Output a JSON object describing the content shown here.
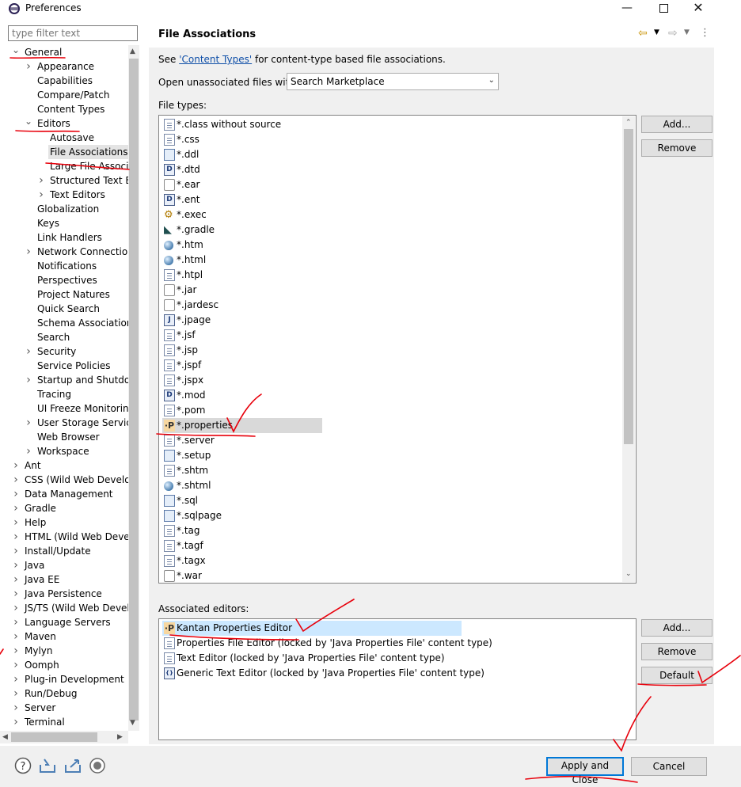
{
  "window": {
    "title": "Preferences"
  },
  "filter": {
    "placeholder": "type filter text"
  },
  "tree": [
    {
      "label": "General",
      "depth": 0,
      "expanded": true
    },
    {
      "label": "Appearance",
      "depth": 1,
      "expandable": true
    },
    {
      "label": "Capabilities",
      "depth": 1
    },
    {
      "label": "Compare/Patch",
      "depth": 1
    },
    {
      "label": "Content Types",
      "depth": 1
    },
    {
      "label": "Editors",
      "depth": 1,
      "expanded": true
    },
    {
      "label": "Autosave",
      "depth": 2
    },
    {
      "label": "File Associations",
      "depth": 2,
      "selected": true
    },
    {
      "label": "Large File Associations",
      "depth": 2
    },
    {
      "label": "Structured Text Editors",
      "depth": 2,
      "expandable": true
    },
    {
      "label": "Text Editors",
      "depth": 2,
      "expandable": true
    },
    {
      "label": "Globalization",
      "depth": 1
    },
    {
      "label": "Keys",
      "depth": 1
    },
    {
      "label": "Link Handlers",
      "depth": 1
    },
    {
      "label": "Network Connections",
      "depth": 1,
      "expandable": true
    },
    {
      "label": "Notifications",
      "depth": 1
    },
    {
      "label": "Perspectives",
      "depth": 1
    },
    {
      "label": "Project Natures",
      "depth": 1
    },
    {
      "label": "Quick Search",
      "depth": 1
    },
    {
      "label": "Schema Associations",
      "depth": 1
    },
    {
      "label": "Search",
      "depth": 1
    },
    {
      "label": "Security",
      "depth": 1,
      "expandable": true
    },
    {
      "label": "Service Policies",
      "depth": 1
    },
    {
      "label": "Startup and Shutdown",
      "depth": 1,
      "expandable": true
    },
    {
      "label": "Tracing",
      "depth": 1
    },
    {
      "label": "UI Freeze Monitoring",
      "depth": 1
    },
    {
      "label": "User Storage Service",
      "depth": 1,
      "expandable": true
    },
    {
      "label": "Web Browser",
      "depth": 1
    },
    {
      "label": "Workspace",
      "depth": 1,
      "expandable": true
    },
    {
      "label": "Ant",
      "depth": 0,
      "expandable": true
    },
    {
      "label": "CSS (Wild Web Developer)",
      "depth": 0,
      "expandable": true
    },
    {
      "label": "Data Management",
      "depth": 0,
      "expandable": true
    },
    {
      "label": "Gradle",
      "depth": 0,
      "expandable": true
    },
    {
      "label": "Help",
      "depth": 0,
      "expandable": true
    },
    {
      "label": "HTML (Wild Web Developer)",
      "depth": 0,
      "expandable": true
    },
    {
      "label": "Install/Update",
      "depth": 0,
      "expandable": true
    },
    {
      "label": "Java",
      "depth": 0,
      "expandable": true
    },
    {
      "label": "Java EE",
      "depth": 0,
      "expandable": true
    },
    {
      "label": "Java Persistence",
      "depth": 0,
      "expandable": true
    },
    {
      "label": "JS/TS (Wild Web Developer)",
      "depth": 0,
      "expandable": true
    },
    {
      "label": "Language Servers",
      "depth": 0,
      "expandable": true
    },
    {
      "label": "Maven",
      "depth": 0,
      "expandable": true
    },
    {
      "label": "Mylyn",
      "depth": 0,
      "expandable": true
    },
    {
      "label": "Oomph",
      "depth": 0,
      "expandable": true
    },
    {
      "label": "Plug-in Development",
      "depth": 0,
      "expandable": true
    },
    {
      "label": "Run/Debug",
      "depth": 0,
      "expandable": true
    },
    {
      "label": "Server",
      "depth": 0,
      "expandable": true
    },
    {
      "label": "Terminal",
      "depth": 0,
      "expandable": true
    }
  ],
  "page": {
    "title": "File Associations",
    "see_prefix": "See ",
    "see_link": "'Content Types'",
    "see_suffix": " for content-type based file associations.",
    "open_label": "Open unassociated files with:",
    "open_value": "Search Marketplace",
    "file_types_label": "File types:",
    "associated_label": "Associated editors:"
  },
  "file_types": [
    {
      "label": "*.class without source",
      "icon": "class-file-icon"
    },
    {
      "label": "*.css",
      "icon": "text-file-icon"
    },
    {
      "label": "*.ddl",
      "icon": "ddl-file-icon"
    },
    {
      "label": "*.dtd",
      "icon": "dtd-file-icon"
    },
    {
      "label": "*.ear",
      "icon": "jar-file-icon"
    },
    {
      "label": "*.ent",
      "icon": "dtd-file-icon"
    },
    {
      "label": "*.exec",
      "icon": "gears-icon"
    },
    {
      "label": "*.gradle",
      "icon": "gradle-elephant-icon"
    },
    {
      "label": "*.htm",
      "icon": "globe-icon"
    },
    {
      "label": "*.html",
      "icon": "globe-icon"
    },
    {
      "label": "*.htpl",
      "icon": "text-file-icon"
    },
    {
      "label": "*.jar",
      "icon": "jar-file-icon"
    },
    {
      "label": "*.jardesc",
      "icon": "jardesc-file-icon"
    },
    {
      "label": "*.jpage",
      "icon": "jpage-file-icon"
    },
    {
      "label": "*.jsf",
      "icon": "text-file-icon"
    },
    {
      "label": "*.jsp",
      "icon": "text-file-icon"
    },
    {
      "label": "*.jspf",
      "icon": "text-file-icon"
    },
    {
      "label": "*.jspx",
      "icon": "text-file-icon"
    },
    {
      "label": "*.mod",
      "icon": "dtd-file-icon"
    },
    {
      "label": "*.pom",
      "icon": "text-file-icon"
    },
    {
      "label": "*.properties",
      "icon": "properties-p-icon",
      "selected": true
    },
    {
      "label": "*.server",
      "icon": "text-file-icon"
    },
    {
      "label": "*.setup",
      "icon": "setup-file-icon"
    },
    {
      "label": "*.shtm",
      "icon": "text-file-icon"
    },
    {
      "label": "*.shtml",
      "icon": "globe-icon"
    },
    {
      "label": "*.sql",
      "icon": "ddl-file-icon"
    },
    {
      "label": "*.sqlpage",
      "icon": "ddl-file-icon"
    },
    {
      "label": "*.tag",
      "icon": "text-file-icon"
    },
    {
      "label": "*.tagf",
      "icon": "text-file-icon"
    },
    {
      "label": "*.tagx",
      "icon": "text-file-icon"
    },
    {
      "label": "*.war",
      "icon": "jar-file-icon"
    }
  ],
  "associated_editors": [
    {
      "label": "Kantan Properties Editor",
      "icon": "properties-p-icon",
      "selected": true
    },
    {
      "label": "Properties File Editor (locked by 'Java Properties File' content type)",
      "icon": "text-file-icon"
    },
    {
      "label": "Text Editor (locked by 'Java Properties File' content type)",
      "icon": "text-file-icon"
    },
    {
      "label": "Generic Text Editor (locked by 'Java Properties File' content type)",
      "icon": "generic-editor-icon"
    }
  ],
  "buttons": {
    "ft_add": "Add...",
    "ft_remove": "Remove",
    "ed_add": "Add...",
    "ed_remove": "Remove",
    "ed_default": "Default",
    "apply_close": "Apply and Close",
    "cancel": "Cancel"
  },
  "colors": {
    "selection": "#cce8ff",
    "annotation": "#e8000b",
    "link": "#0f4fa8"
  }
}
